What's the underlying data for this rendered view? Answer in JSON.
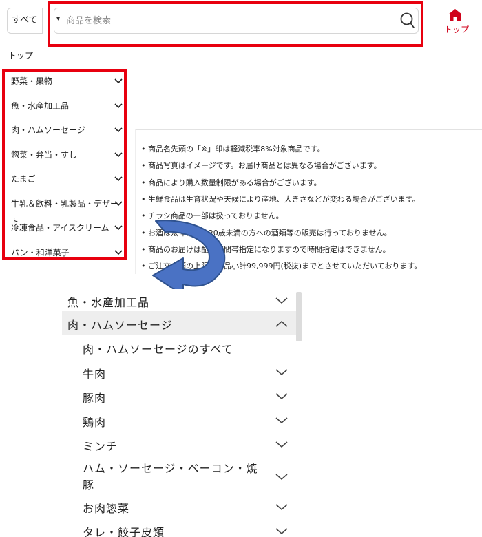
{
  "header": {
    "scope_label": "すべて",
    "search_placeholder": "商品を検索",
    "home_label": "トップ"
  },
  "breadcrumb": "トップ",
  "categories": [
    "野菜・果物",
    "魚・水産加工品",
    "肉・ハムソーセージ",
    "惣菜・弁当・すし",
    "たまご",
    "牛乳＆飲料・乳製品・デザート",
    "冷凍食品・アイスクリーム",
    "パン・和洋菓子"
  ],
  "notices": [
    "商品名先頭の「※」印は軽減税率8%対象商品です。",
    "商品写真はイメージです。お届け商品とは異なる場合がございます。",
    "商品により購入数量制限がある場合がございます。",
    "生鮮食品は生育状況や天候により産地、大きさなどが変わる場合がございます。",
    "チラシ商品の一部は扱っておりません。",
    "お酒は法律により20歳未満の方への酒類等の販売は行っておりません。",
    "商品のお届けは配送時間帯指定になりますので時間指定はできません。",
    "ご注文金額の上限は商品小計99,999円(税抜)までとさせていただいております。"
  ],
  "expanded_menu": {
    "items": [
      {
        "label": "魚・水産加工品",
        "level": 0,
        "expanded": false
      },
      {
        "label": "肉・ハムソーセージ",
        "level": 0,
        "expanded": true
      },
      {
        "label": "肉・ハムソーセージのすべて",
        "level": 1,
        "expanded": null
      },
      {
        "label": "牛肉",
        "level": 1,
        "expanded": false
      },
      {
        "label": "豚肉",
        "level": 1,
        "expanded": false
      },
      {
        "label": "鶏肉",
        "level": 1,
        "expanded": false
      },
      {
        "label": "ミンチ",
        "level": 1,
        "expanded": false
      },
      {
        "label": "ハム・ソーセージ・ベーコン・焼豚",
        "level": 1,
        "expanded": false
      },
      {
        "label": "お肉惣菜",
        "level": 1,
        "expanded": false
      },
      {
        "label": "タレ・餃子皮類",
        "level": 1,
        "expanded": false
      }
    ]
  },
  "colors": {
    "highlight": "#e8000f",
    "brand_red": "#d0021b",
    "arrow_fill": "#4a72c4",
    "arrow_stroke": "#2f528f"
  }
}
